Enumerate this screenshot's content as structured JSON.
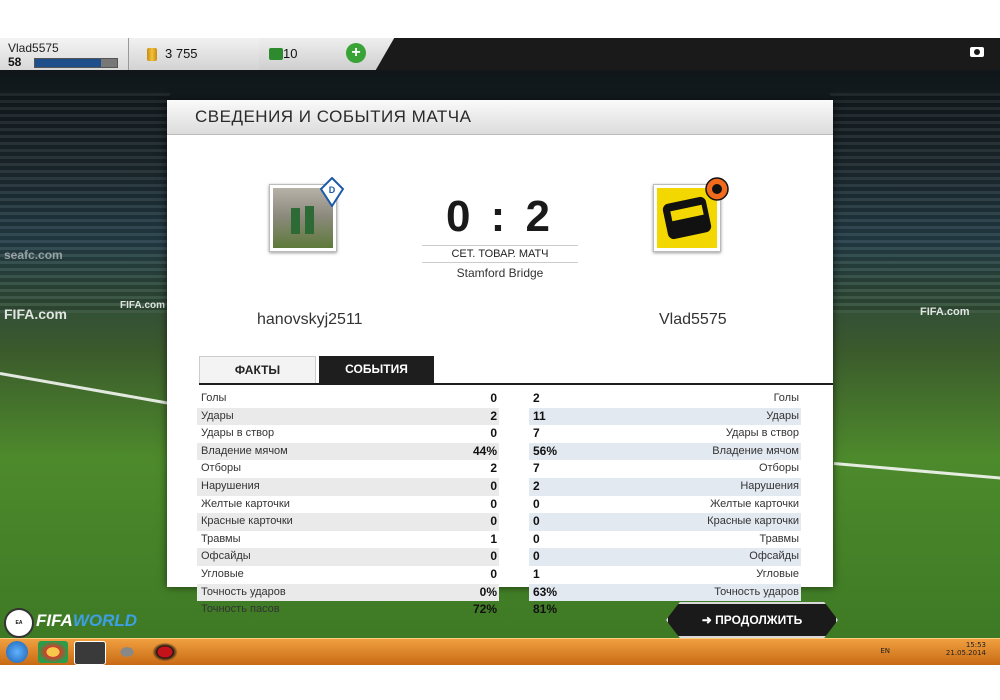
{
  "header": {
    "username": "Vlad5575",
    "level": "58",
    "level_progress": 0.8,
    "coins": "3 755",
    "points": "10",
    "add_points_label": "+"
  },
  "panel": {
    "title": "СВЕДЕНИЯ И СОБЫТИЯ МАТЧА",
    "home_team": "hanovskyj2511",
    "away_team": "Vlad5575",
    "score": "0 : 2",
    "match_type": "СЕТ. ТОВАР. МАТЧ",
    "stadium": "Stamford Bridge",
    "tabs": {
      "facts": "ФАКТЫ",
      "events": "СОБЫТИЯ"
    }
  },
  "stats": [
    {
      "label": "Голы",
      "home": "0",
      "away": "2"
    },
    {
      "label": "Удары",
      "home": "2",
      "away": "11"
    },
    {
      "label": "Удары в створ",
      "home": "0",
      "away": "7"
    },
    {
      "label": "Владение мячом",
      "home": "44%",
      "away": "56%"
    },
    {
      "label": "Отборы",
      "home": "2",
      "away": "7"
    },
    {
      "label": "Нарушения",
      "home": "0",
      "away": "2"
    },
    {
      "label": "Желтые карточки",
      "home": "0",
      "away": "0"
    },
    {
      "label": "Красные карточки",
      "home": "0",
      "away": "0"
    },
    {
      "label": "Травмы",
      "home": "1",
      "away": "0"
    },
    {
      "label": "Офсайды",
      "home": "0",
      "away": "0"
    },
    {
      "label": "Угловые",
      "home": "0",
      "away": "1"
    },
    {
      "label": "Точность ударов",
      "home": "0%",
      "away": "63%"
    },
    {
      "label": "Точность пасов",
      "home": "72%",
      "away": "81%"
    }
  ],
  "continue_label": "ПРОДОЛЖИТЬ",
  "logo": {
    "ea": "EA SPORTS",
    "brand_a": "FIFA",
    "brand_b": "WORLD"
  },
  "background_ads": [
    "FIFA.com",
    "FIFA.com",
    "FIFA.com",
    "seafc.com"
  ],
  "taskbar": {
    "lang": "EN",
    "time": "15:53",
    "date": "21.05.2014"
  },
  "colors": {
    "accent": "#3aa335",
    "dark": "#1e1e1e",
    "taskbar": "#e08a2a"
  }
}
